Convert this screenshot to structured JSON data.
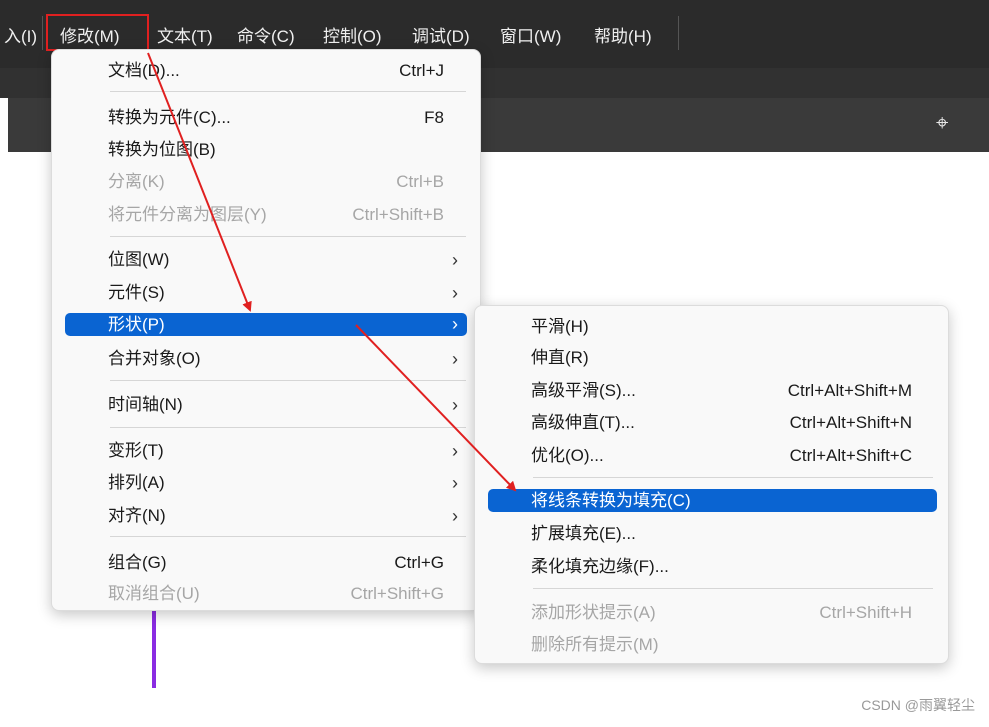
{
  "menubar": {
    "items": [
      "入(I)",
      "修改(M)",
      "文本(T)",
      "命令(C)",
      "控制(O)",
      "调试(D)",
      "窗口(W)",
      "帮助(H)"
    ],
    "crosshair_icon": "crosshair-icon"
  },
  "modify_menu": {
    "items": [
      {
        "label": "文档(D)...",
        "shortcut": "Ctrl+J"
      },
      {
        "label": "转换为元件(C)...",
        "shortcut": "F8"
      },
      {
        "label": "转换为位图(B)",
        "shortcut": ""
      },
      {
        "label": "分离(K)",
        "shortcut": "Ctrl+B",
        "disabled": true
      },
      {
        "label": "将元件分离为图层(Y)",
        "shortcut": "Ctrl+Shift+B",
        "disabled": true
      },
      {
        "label": "位图(W)",
        "submenu": true
      },
      {
        "label": "元件(S)",
        "submenu": true
      },
      {
        "label": "形状(P)",
        "submenu": true,
        "selected": true
      },
      {
        "label": "合并对象(O)",
        "submenu": true
      },
      {
        "label": "时间轴(N)",
        "submenu": true
      },
      {
        "label": "变形(T)",
        "submenu": true
      },
      {
        "label": "排列(A)",
        "submenu": true
      },
      {
        "label": "对齐(N)",
        "submenu": true
      },
      {
        "label": "组合(G)",
        "shortcut": "Ctrl+G"
      },
      {
        "label": "取消组合(U)",
        "shortcut": "Ctrl+Shift+G",
        "disabled": true
      }
    ]
  },
  "shape_submenu": {
    "items": [
      {
        "label": "平滑(H)",
        "shortcut": ""
      },
      {
        "label": "伸直(R)",
        "shortcut": ""
      },
      {
        "label": "高级平滑(S)...",
        "shortcut": "Ctrl+Alt+Shift+M"
      },
      {
        "label": "高级伸直(T)...",
        "shortcut": "Ctrl+Alt+Shift+N"
      },
      {
        "label": "优化(O)...",
        "shortcut": "Ctrl+Alt+Shift+C"
      },
      {
        "label": "将线条转换为填充(C)",
        "shortcut": "",
        "selected": true
      },
      {
        "label": "扩展填充(E)...",
        "shortcut": ""
      },
      {
        "label": "柔化填充边缘(F)...",
        "shortcut": ""
      },
      {
        "label": "添加形状提示(A)",
        "shortcut": "Ctrl+Shift+H",
        "disabled": true
      },
      {
        "label": "删除所有提示(M)",
        "shortcut": "",
        "disabled": true
      }
    ]
  },
  "colors": {
    "highlight": "#0a64d2",
    "annotation": "#e02020",
    "stage_line": "#8a2be2"
  },
  "watermark": "CSDN @雨翼轻尘"
}
